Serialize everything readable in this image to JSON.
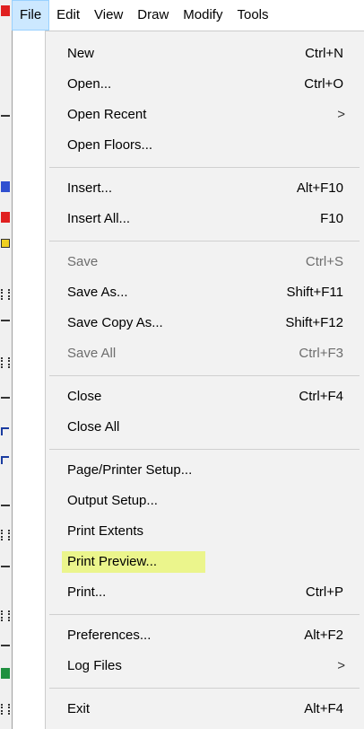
{
  "menubar": {
    "items": [
      "File",
      "Edit",
      "View",
      "Draw",
      "Modify",
      "Tools"
    ],
    "active": "File"
  },
  "file_menu": {
    "items": [
      {
        "label": "New",
        "shortcut": "Ctrl+N",
        "enabled": true
      },
      {
        "label": "Open...",
        "shortcut": "Ctrl+O",
        "enabled": true
      },
      {
        "label": "Open Recent",
        "shortcut": "",
        "submenu": true,
        "enabled": true
      },
      {
        "label": "Open Floors...",
        "shortcut": "",
        "enabled": true
      },
      {
        "label": "Insert...",
        "shortcut": "Alt+F10",
        "enabled": true
      },
      {
        "label": "Insert All...",
        "shortcut": "F10",
        "enabled": true
      },
      {
        "label": "Save",
        "shortcut": "Ctrl+S",
        "enabled": false
      },
      {
        "label": "Save As...",
        "shortcut": "Shift+F11",
        "enabled": true
      },
      {
        "label": "Save Copy As...",
        "shortcut": "Shift+F12",
        "enabled": true
      },
      {
        "label": "Save All",
        "shortcut": "Ctrl+F3",
        "enabled": false
      },
      {
        "label": "Close",
        "shortcut": "Ctrl+F4",
        "enabled": true
      },
      {
        "label": "Close All",
        "shortcut": "",
        "enabled": true
      },
      {
        "label": "Page/Printer Setup...",
        "shortcut": "",
        "enabled": true
      },
      {
        "label": "Output Setup...",
        "shortcut": "",
        "enabled": true
      },
      {
        "label": "Print Extents",
        "shortcut": "",
        "enabled": true
      },
      {
        "label": "Print Preview...",
        "shortcut": "",
        "enabled": true,
        "highlighted": true
      },
      {
        "label": "Print...",
        "shortcut": "Ctrl+P",
        "enabled": true
      },
      {
        "label": "Preferences...",
        "shortcut": "Alt+F2",
        "enabled": true
      },
      {
        "label": "Log Files",
        "shortcut": "",
        "submenu": true,
        "enabled": true
      },
      {
        "label": "Exit",
        "shortcut": "Alt+F4",
        "enabled": true
      }
    ],
    "submenu_arrow": ">"
  },
  "colors": {
    "menu_bg": "#f2f2f2",
    "active_menu_bg": "#cce8ff",
    "highlight_bg": "#ebf58c",
    "disabled_text": "#6d6d6d"
  }
}
